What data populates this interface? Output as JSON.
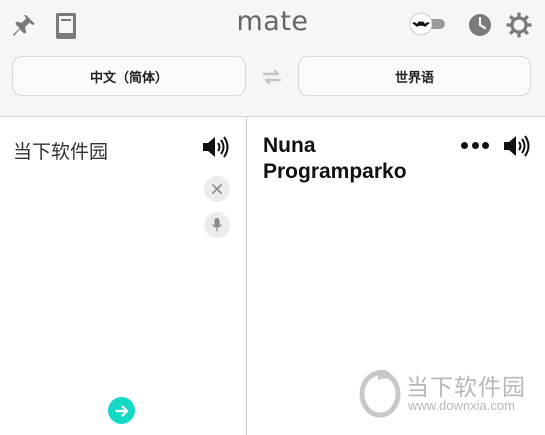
{
  "app": {
    "title": "mate"
  },
  "header": {
    "icons": [
      "pin-icon",
      "book-icon",
      "bat-toggle-icon",
      "clock-icon",
      "gear-icon"
    ]
  },
  "languages": {
    "source": "中文（简体）",
    "target": "世界语",
    "swap_icon": "swap-arrows-icon"
  },
  "source_panel": {
    "text": "当下软件园",
    "speaker_icon": "speaker-icon",
    "clear_icon": "close-icon",
    "mic_icon": "microphone-icon",
    "go_icon": "arrow-right-icon"
  },
  "target_panel": {
    "line1": "Nuna",
    "line2": "Programparko",
    "more_icon": "more-dots-icon",
    "speaker_icon": "speaker-icon"
  },
  "watermark": {
    "name": "当下软件园",
    "url": "www.downxia.com"
  },
  "colors": {
    "accent": "#14d9c7",
    "header_bg": "#f6f6f6",
    "icon_gray": "#777777"
  }
}
